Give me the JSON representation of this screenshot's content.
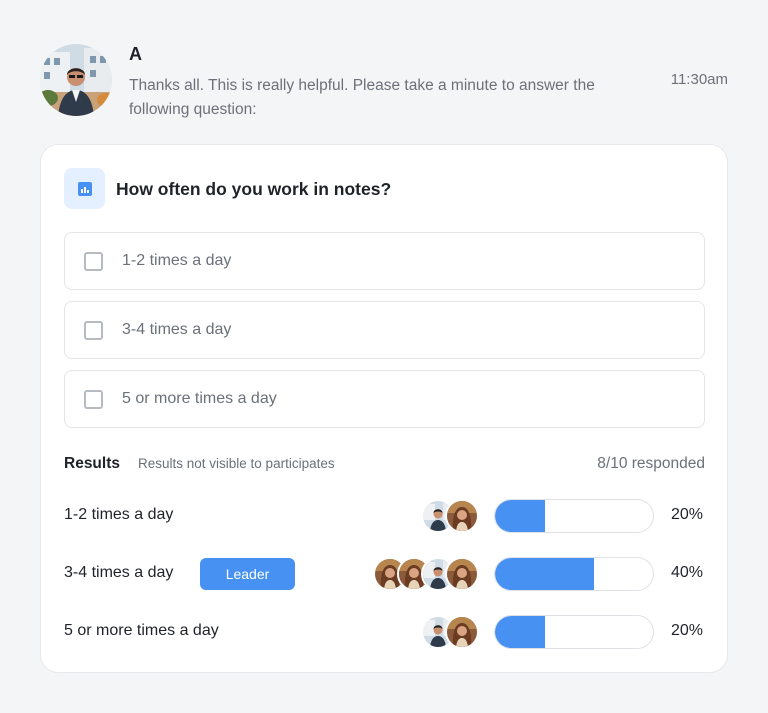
{
  "message": {
    "sender": "A",
    "text": "Thanks all. This is really helpful. Please take a minute to answer the following question:",
    "time": "11:30am"
  },
  "poll": {
    "icon": "bar-chart-icon",
    "question": "How often do you work in notes?",
    "options": [
      {
        "label": "1-2 times a day",
        "checked": false
      },
      {
        "label": "3-4 times a day",
        "checked": false
      },
      {
        "label": "5 or more times a day",
        "checked": false
      }
    ],
    "results": {
      "title": "Results",
      "note": "Results not visible to participates",
      "responded": "8/10 responded",
      "rows": [
        {
          "label": "1-2 times a day",
          "percent_text": "20%",
          "fraction": 0.2,
          "avatars": [
            "man",
            "woman"
          ],
          "leader": false
        },
        {
          "label": "3-4 times a day",
          "percent_text": "40%",
          "fraction": 0.4,
          "avatars": [
            "woman",
            "woman",
            "man",
            "woman"
          ],
          "leader": true,
          "leader_label": "Leader"
        },
        {
          "label": "5 or more times a day",
          "percent_text": "20%",
          "fraction": 0.2,
          "avatars": [
            "man",
            "woman"
          ],
          "leader": false
        }
      ]
    }
  },
  "colors": {
    "accent": "#4691f2",
    "accent_soft": "#e4efff",
    "text_primary": "#1f2329",
    "text_secondary": "#6b7079",
    "background": "#f4f5f7"
  }
}
